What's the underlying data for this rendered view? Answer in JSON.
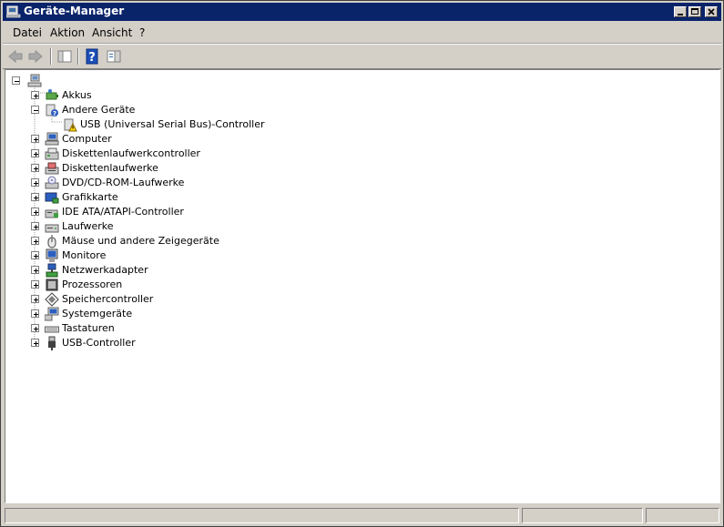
{
  "window": {
    "title": "Geräte-Manager"
  },
  "menu": {
    "items": [
      "Datei",
      "Aktion",
      "Ansicht",
      "?"
    ]
  },
  "toolbar": {
    "buttons": [
      "back-arrow-icon",
      "forward-arrow-icon",
      "show-hide-tree-icon",
      "help-icon",
      "properties-view-icon"
    ]
  },
  "tree": {
    "root_icon": "computer-icon",
    "categories": [
      {
        "label": "Akkus",
        "icon": "battery-icon",
        "expanded": false
      },
      {
        "label": "Andere Geräte",
        "icon": "unknown-device-icon",
        "expanded": true
      },
      {
        "label": "USB (Universal Serial Bus)-Controller",
        "icon": "warning-device-icon",
        "child": true
      },
      {
        "label": "Computer",
        "icon": "computer-icon",
        "expanded": false
      },
      {
        "label": "Diskettenlaufwerkcontroller",
        "icon": "floppy-controller-icon",
        "expanded": false
      },
      {
        "label": "Diskettenlaufwerke",
        "icon": "floppy-drive-icon",
        "expanded": false
      },
      {
        "label": "DVD/CD-ROM-Laufwerke",
        "icon": "cdrom-icon",
        "expanded": false
      },
      {
        "label": "Grafikkarte",
        "icon": "display-adapter-icon",
        "expanded": false
      },
      {
        "label": "IDE ATA/ATAPI-Controller",
        "icon": "ide-controller-icon",
        "expanded": false
      },
      {
        "label": "Laufwerke",
        "icon": "disk-drive-icon",
        "expanded": false
      },
      {
        "label": "Mäuse und andere Zeigegeräte",
        "icon": "mouse-icon",
        "expanded": false
      },
      {
        "label": "Monitore",
        "icon": "monitor-icon",
        "expanded": false
      },
      {
        "label": "Netzwerkadapter",
        "icon": "network-adapter-icon",
        "expanded": false
      },
      {
        "label": "Prozessoren",
        "icon": "processor-icon",
        "expanded": false
      },
      {
        "label": "Speichercontroller",
        "icon": "storage-controller-icon",
        "expanded": false
      },
      {
        "label": "Systemgeräte",
        "icon": "system-device-icon",
        "expanded": false
      },
      {
        "label": "Tastaturen",
        "icon": "keyboard-icon",
        "expanded": false
      },
      {
        "label": "USB-Controller",
        "icon": "usb-icon",
        "expanded": false
      }
    ]
  },
  "colors": {
    "titlebar": "#0a246a",
    "face": "#d4d0c8",
    "window_bg": "#ffffff"
  }
}
